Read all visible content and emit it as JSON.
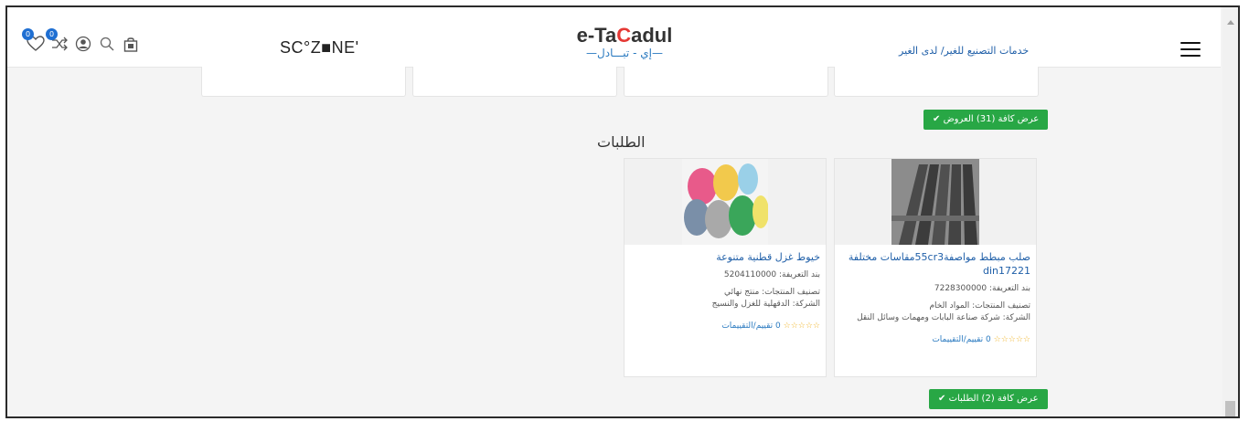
{
  "header": {
    "badge_wishlist": "0",
    "badge_compare": "0",
    "brand_left": "SC°Z■NE'",
    "logo_main_a": "e-Ta",
    "logo_main_accent": "C",
    "logo_main_b": "adul",
    "logo_sub": "—إي - تبـــادل—",
    "top_link": "خدمات التصنيع للغير/ لدى الغير"
  },
  "offers": {
    "view_all_label": "✔ عرض كافة (31) العروض"
  },
  "requests": {
    "section_title": "الطلبات",
    "view_all_label": "✔ عرض كافة (2) الطلبات",
    "items": [
      {
        "title": "صلب مبطط مواصفة55cr3مقاسات مختلفة din17221",
        "code_line": "بند التعريفة: 7228300000",
        "category_line": "تصنيف المنتجات: المواد الخام",
        "company_line": "الشركة: شركة صناعة البابات ومهمات وسائل النقل",
        "stars": "☆☆☆☆☆",
        "rating_text": "0 تقييم/التقييمات",
        "image_icon": "steel-bars-image"
      },
      {
        "title": "خيوط غزل قطنية متنوعة",
        "code_line": "بند التعريفة: 5204110000",
        "category_line": "تصنيف المنتجات: منتج نهائي",
        "company_line": "الشركة: الدقهلية للغزل والنسيج",
        "stars": "☆☆☆☆☆",
        "rating_text": "0 تقييم/التقييمات",
        "image_icon": "yarn-spools-image"
      }
    ]
  },
  "colors": {
    "accent_green": "#28a745",
    "link_blue": "#1f5fa8",
    "badge_blue": "#1f6fd2",
    "star_gold": "#f0b429"
  }
}
